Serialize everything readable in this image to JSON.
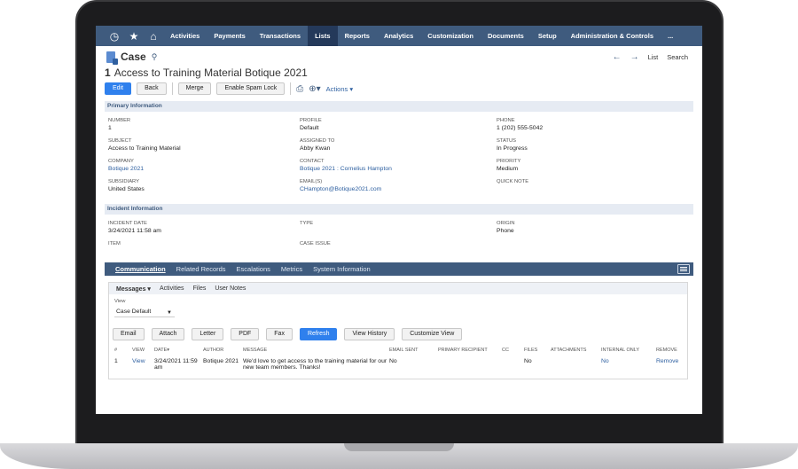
{
  "nav": {
    "items": [
      "Activities",
      "Payments",
      "Transactions",
      "Lists",
      "Reports",
      "Analytics",
      "Customization",
      "Documents",
      "Setup",
      "Administration & Controls",
      "..."
    ],
    "active_index": 3
  },
  "header": {
    "record_type": "Case",
    "number": "1",
    "title": "Access to Training Material Botique 2021",
    "list_link": "List",
    "search_link": "Search"
  },
  "toolbar": {
    "edit": "Edit",
    "back": "Back",
    "merge": "Merge",
    "spam": "Enable Spam Lock",
    "actions": "Actions"
  },
  "primary": {
    "section_title": "Primary Information",
    "number_label": "Number",
    "number": "1",
    "profile_label": "Profile",
    "profile": "Default",
    "phone_label": "Phone",
    "phone": "1 (202) 555-5042",
    "subject_label": "Subject",
    "subject": "Access to Training Material",
    "assigned_label": "Assigned To",
    "assigned": "Abby Kwan",
    "status_label": "Status",
    "status": "In Progress",
    "company_label": "Company",
    "company": "Botique 2021",
    "contact_label": "Contact",
    "contact": "Botique 2021 : Cornelius Hampton",
    "priority_label": "Priority",
    "priority": "Medium",
    "subsidiary_label": "Subsidiary",
    "subsidiary": "United States",
    "email_label": "Email(s)",
    "email": "CHampton@Botique2021.com",
    "quicknote_label": "Quick Note",
    "quicknote": ""
  },
  "incident": {
    "section_title": "Incident Information",
    "date_label": "Incident Date",
    "date": "3/24/2021 11:58 am",
    "type_label": "Type",
    "type": "",
    "origin_label": "Origin",
    "origin": "Phone",
    "item_label": "Item",
    "item": "",
    "issue_label": "Case Issue",
    "issue": ""
  },
  "subtabs": [
    "Communication",
    "Related Records",
    "Escalations",
    "Metrics",
    "System Information"
  ],
  "communication": {
    "inner_tabs": [
      "Messages",
      "Activities",
      "Files",
      "User Notes"
    ],
    "view_label": "View",
    "view_value": "Case Default",
    "buttons": [
      "Email",
      "Attach",
      "Letter",
      "PDF",
      "Fax",
      "Refresh",
      "View History",
      "Customize View"
    ],
    "columns": [
      "#",
      "View",
      "Date",
      "Author",
      "Message",
      "Email Sent",
      "Primary Recipient",
      "CC",
      "Files",
      "Attachments",
      "Internal Only",
      "Remove"
    ],
    "row": {
      "num": "1",
      "view": "View",
      "date": "3/24/2021 11:59 am",
      "author": "Botique 2021",
      "message": "We'd love to get access to the training material for our new team members. Thanks!",
      "email_sent": "No",
      "recipient": "",
      "cc": "",
      "files": "No",
      "attachments": "",
      "internal": "No",
      "remove": "Remove"
    }
  }
}
